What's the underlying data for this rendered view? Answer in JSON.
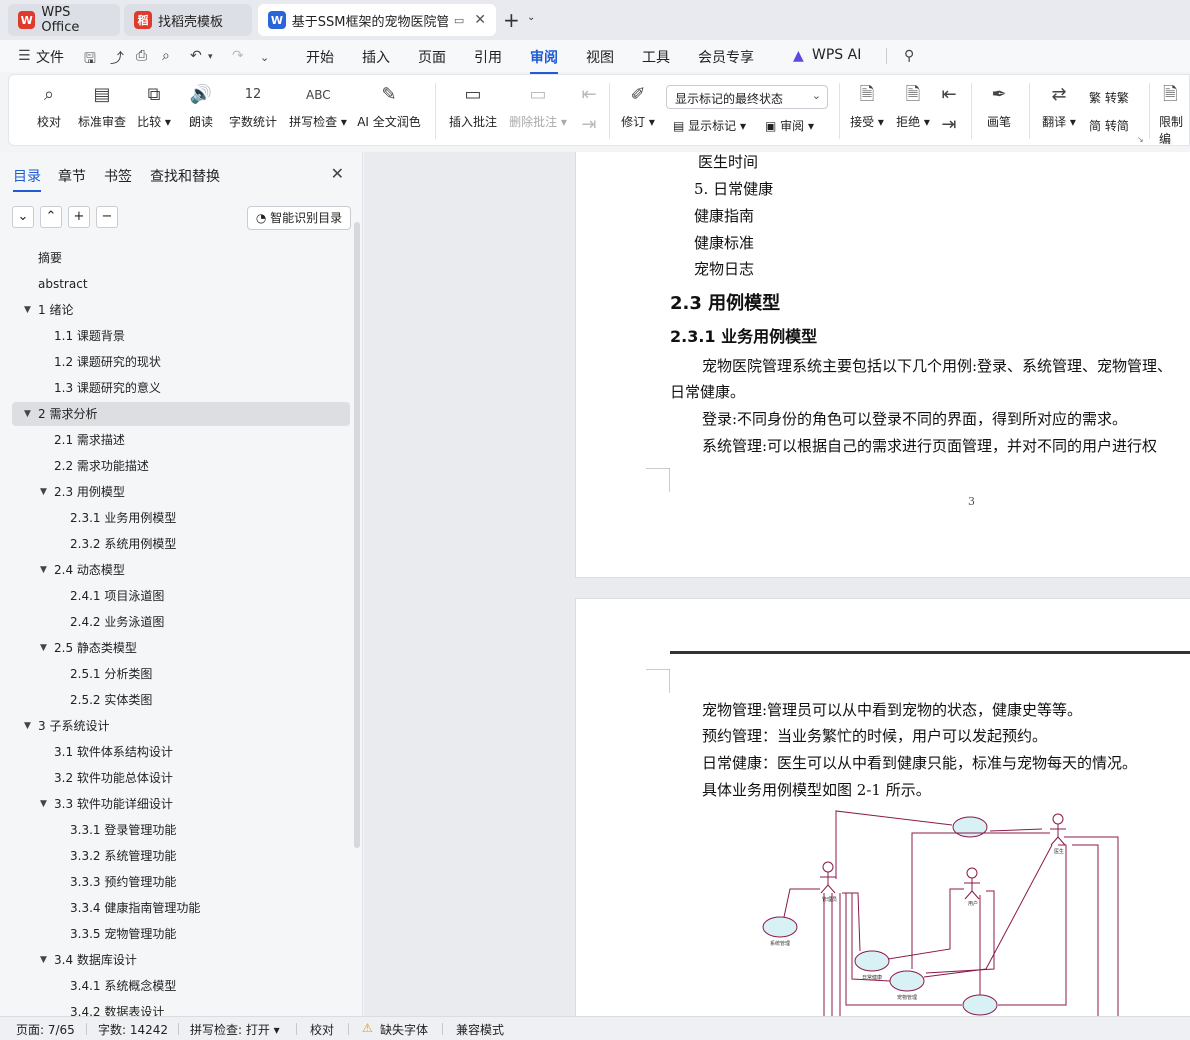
{
  "tabs": [
    {
      "label": "WPS Office",
      "logo": "W",
      "logo_color": "#e03a2f"
    },
    {
      "label": "找稻壳模板",
      "logo": "稻",
      "logo_color": "#e03a2f"
    },
    {
      "label": "基于SSM框架的宠物医院管理",
      "logo": "W",
      "logo_color": "#2b66d9"
    }
  ],
  "menu": {
    "file": "文件",
    "items": [
      "开始",
      "插入",
      "页面",
      "引用",
      "审阅",
      "视图",
      "工具",
      "会员专享"
    ],
    "active": "审阅",
    "wps_ai": "WPS AI"
  },
  "ribbon": {
    "proofread": "校对",
    "standard_review": "标准审查",
    "compare": "比较",
    "read_aloud": "朗读",
    "word_count": "字数统计",
    "spell_check": "拼写检查",
    "ai_polish": "AI 全文润色",
    "insert_comment": "插入批注",
    "delete_comment": "删除批注",
    "track_changes": "修订",
    "display_state": "显示标记的最终状态",
    "show_markup": "显示标记",
    "review_pane": "审阅",
    "accept": "接受",
    "reject": "拒绝",
    "pen": "画笔",
    "translate": "翻译",
    "to_traditional": "转繁",
    "to_simplified": "转简",
    "restrict": "限制编"
  },
  "nav": {
    "tabs": [
      "目录",
      "章节",
      "书签",
      "查找和替换"
    ],
    "active_tab": "目录",
    "smart_button": "智能识别目录",
    "toc": [
      {
        "level": 1,
        "text": "摘要",
        "arrow": false
      },
      {
        "level": 1,
        "text": "abstract",
        "arrow": false
      },
      {
        "level": 1,
        "text": "1  绪论",
        "arrow": true
      },
      {
        "level": 2,
        "text": "1.1  课题背景",
        "arrow": false
      },
      {
        "level": 2,
        "text": "1.2  课题研究的现状",
        "arrow": false
      },
      {
        "level": 2,
        "text": "1.3  课题研究的意义",
        "arrow": false
      },
      {
        "level": 1,
        "text": "2  需求分析",
        "arrow": true,
        "selected": true
      },
      {
        "level": 2,
        "text": "2.1  需求描述",
        "arrow": false
      },
      {
        "level": 2,
        "text": "2.2  需求功能描述",
        "arrow": false
      },
      {
        "level": 2,
        "text": "2.3  用例模型",
        "arrow": true
      },
      {
        "level": 3,
        "text": "2.3.1  业务用例模型",
        "arrow": false
      },
      {
        "level": 3,
        "text": "2.3.2  系统用例模型",
        "arrow": false
      },
      {
        "level": 2,
        "text": "2.4  动态模型",
        "arrow": true
      },
      {
        "level": 3,
        "text": "2.4.1  项目泳道图",
        "arrow": false
      },
      {
        "level": 3,
        "text": "2.4.2  业务泳道图",
        "arrow": false
      },
      {
        "level": 2,
        "text": "2.5  静态类模型",
        "arrow": true
      },
      {
        "level": 3,
        "text": "2.5.1  分析类图",
        "arrow": false
      },
      {
        "level": 3,
        "text": "2.5.2  实体类图",
        "arrow": false
      },
      {
        "level": 1,
        "text": "3  子系统设计",
        "arrow": true
      },
      {
        "level": 2,
        "text": "3.1  软件体系结构设计",
        "arrow": false
      },
      {
        "level": 2,
        "text": "3.2  软件功能总体设计",
        "arrow": false
      },
      {
        "level": 2,
        "text": "3.3  软件功能详细设计",
        "arrow": true
      },
      {
        "level": 3,
        "text": "3.3.1  登录管理功能",
        "arrow": false
      },
      {
        "level": 3,
        "text": "3.3.2  系统管理功能",
        "arrow": false
      },
      {
        "level": 3,
        "text": "3.3.3  预约管理功能",
        "arrow": false
      },
      {
        "level": 3,
        "text": "3.3.4  健康指南管理功能",
        "arrow": false
      },
      {
        "level": 3,
        "text": "3.3.5  宠物管理功能",
        "arrow": false
      },
      {
        "level": 2,
        "text": "3.4  数据库设计",
        "arrow": true
      },
      {
        "level": 3,
        "text": "3.4.1  系统概念模型",
        "arrow": false
      },
      {
        "level": 3,
        "text": "3.4.2  数据表设计",
        "arrow": false
      }
    ]
  },
  "doc": {
    "page1": {
      "lines": [
        "医生时间",
        "5. 日常健康",
        "健康指南",
        "健康标准",
        "宠物日志"
      ],
      "h2": "2.3  用例模型",
      "h3": "2.3.1  业务用例模型",
      "para1a": "宠物医院管理系统主要包括以下几个用例:登录、系统管理、宠物管理、",
      "para1b": "日常健康。",
      "para2": "登录:不同身份的角色可以登录不同的界面，得到所对应的需求。",
      "para3": "系统管理:可以根据自己的需求进行页面管理，并对不同的用户进行权",
      "page_number": "3"
    },
    "page2": {
      "lines": [
        "宠物管理:管理员可以从中看到宠物的状态，健康史等等。",
        "预约管理：当业务繁忙的时候，用户可以发起预约。",
        "日常健康：医生可以从中看到健康只能，标准与宠物每天的情况。",
        "具体业务用例模型如图 2-1 所示。"
      ],
      "diagram_labels": {
        "admin": "管理员",
        "user": "用户",
        "doctor": "医生",
        "sys_mgmt": "系统管理",
        "daily_health": "日常健康",
        "pet_mgmt": "宠物管理"
      }
    }
  },
  "status": {
    "page": "页面: 7/65",
    "words": "字数: 14242",
    "spell": "拼写检查: 打开",
    "proof": "校对",
    "missing_font": "缺失字体",
    "compat": "兼容模式"
  },
  "colors": {
    "accent": "#1f5bd6",
    "diagram": "#8b1a4a"
  }
}
